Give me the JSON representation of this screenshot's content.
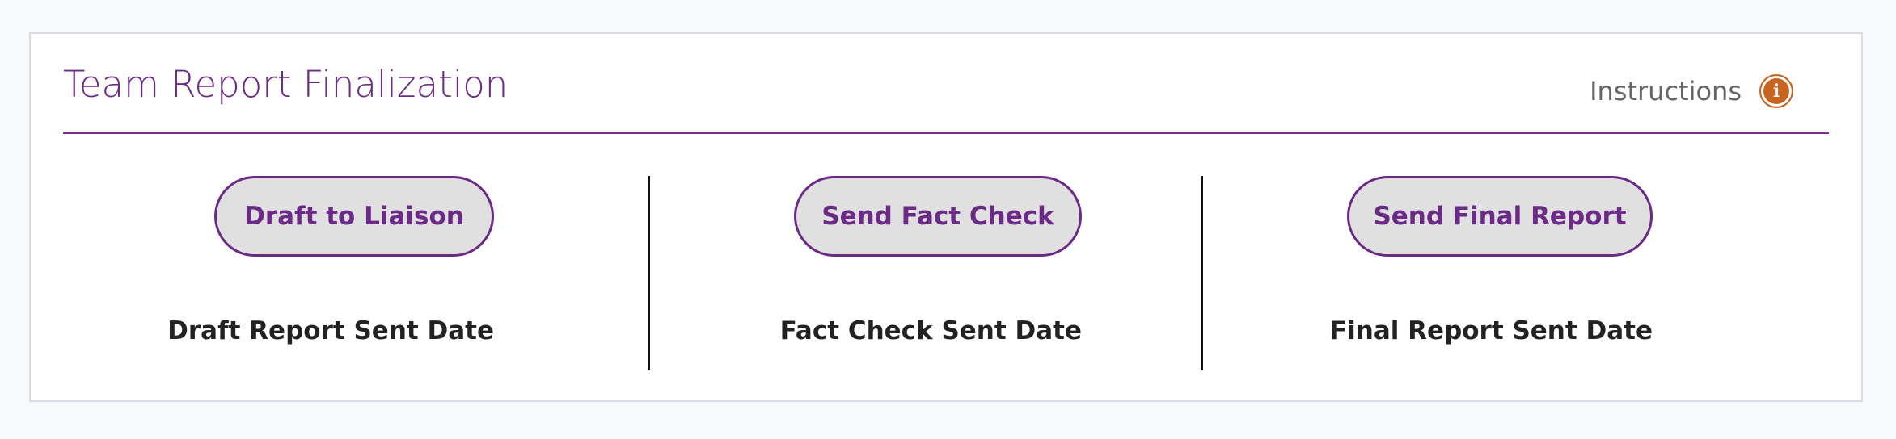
{
  "header": {
    "title": "Team Report Finalization",
    "instructions_label": "Instructions",
    "info_icon": "info-icon",
    "info_glyph": "i"
  },
  "actions": [
    {
      "button_label": "Draft to Liaison",
      "date_label": "Draft Report Sent Date"
    },
    {
      "button_label": "Send Fact Check",
      "date_label": "Fact Check Sent Date"
    },
    {
      "button_label": "Send Final Report",
      "date_label": "Final Report Sent Date"
    }
  ],
  "colors": {
    "accent": "#6b2a86",
    "button_fill": "#e0e0e0",
    "info_icon": "#c8641f",
    "text_dark": "#222222",
    "text_muted": "#666666"
  }
}
